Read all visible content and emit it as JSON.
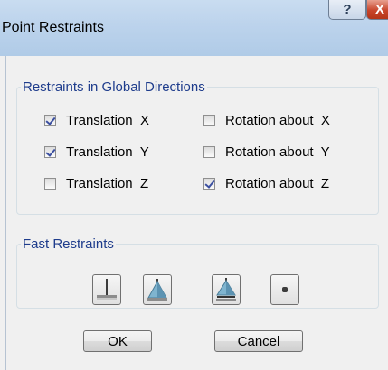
{
  "window": {
    "title": "Point Restraints",
    "help_glyph": "?",
    "close_glyph": "X"
  },
  "global_group": {
    "legend": "Restraints in Global Directions",
    "options": [
      {
        "label": "Translation  X",
        "checked": true
      },
      {
        "label": "Translation  Y",
        "checked": true
      },
      {
        "label": "Translation  Z",
        "checked": false
      },
      {
        "label": "Rotation about  X",
        "checked": false
      },
      {
        "label": "Rotation about  Y",
        "checked": false
      },
      {
        "label": "Rotation about  Z",
        "checked": true
      }
    ]
  },
  "fast_group": {
    "legend": "Fast Restraints",
    "buttons": [
      {
        "icon": "fixed-support-icon"
      },
      {
        "icon": "pinned-support-icon"
      },
      {
        "icon": "roller-support-icon"
      },
      {
        "icon": "free-point-icon"
      }
    ]
  },
  "actions": {
    "ok_label": "OK",
    "cancel_label": "Cancel"
  },
  "colors": {
    "titlebar": "#bcd3ec",
    "legend_text": "#1e3c8c",
    "support_icon": "#7fb4cf"
  }
}
